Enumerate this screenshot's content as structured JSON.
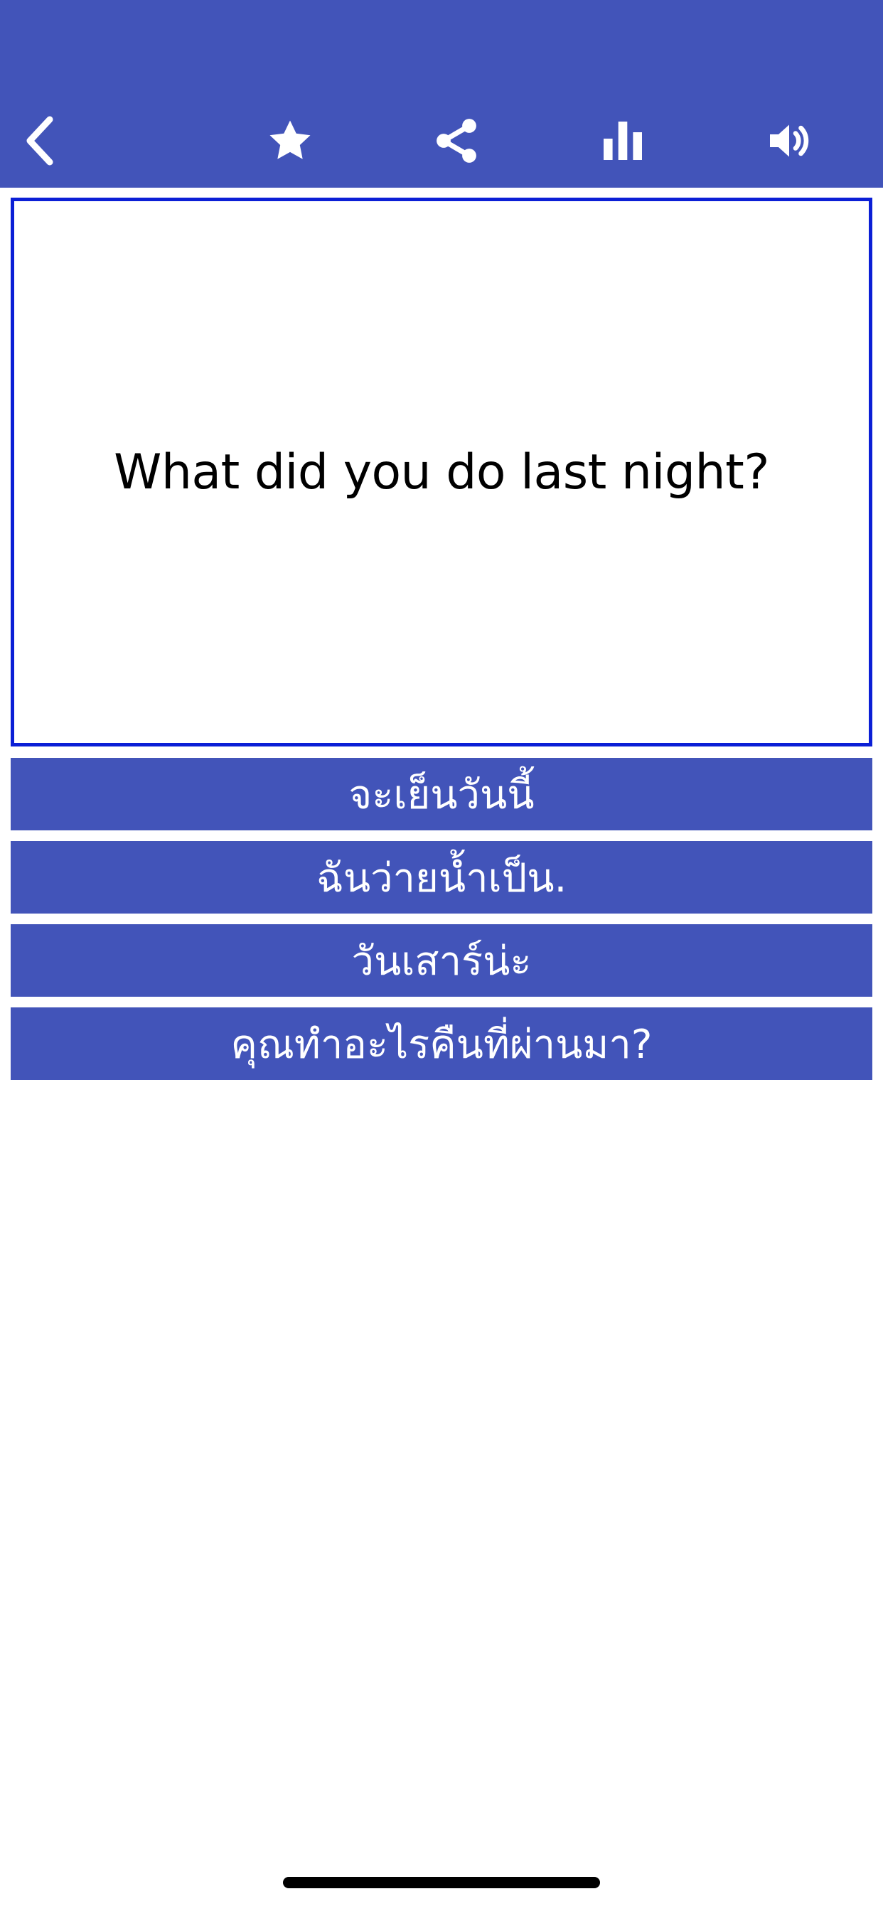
{
  "toolbar": {
    "background": "#4254b9",
    "icons": [
      "back-chevron-icon",
      "star-icon",
      "share-icon",
      "bar-chart-icon",
      "speaker-icon"
    ]
  },
  "question": {
    "text": "What did you do last night?",
    "border_color": "#0b1fd6"
  },
  "answers": [
    {
      "label": "จะเย็นวันนี้"
    },
    {
      "label": "ฉันว่ายน้ำเป็น."
    },
    {
      "label": "วันเสาร์น่ะ"
    },
    {
      "label": "คุณทำอะไรคืนที่ผ่านมา?"
    }
  ]
}
